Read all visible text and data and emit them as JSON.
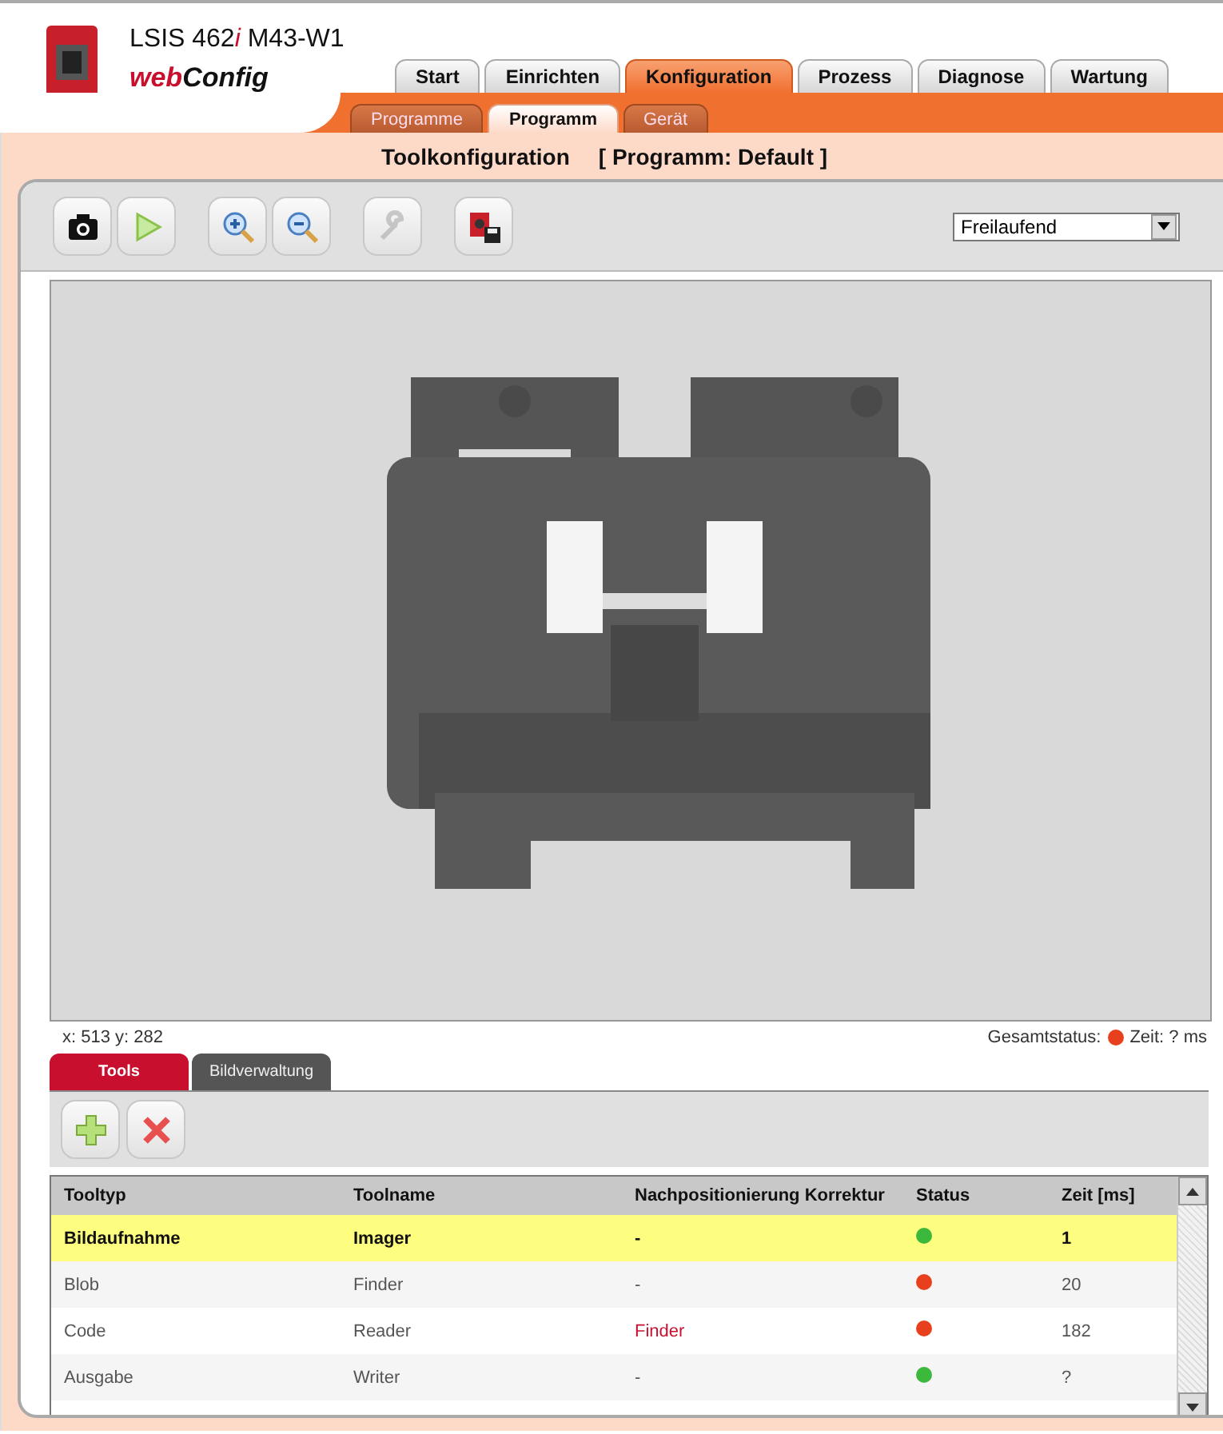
{
  "header": {
    "device_model": "LSIS 462",
    "device_suffix": "i",
    "device_variant": "M43-W1",
    "product_prefix": "web",
    "product_name": "Config"
  },
  "main_tabs": [
    {
      "label": "Start",
      "selected": false
    },
    {
      "label": "Einrichten",
      "selected": false
    },
    {
      "label": "Konfiguration",
      "selected": true
    },
    {
      "label": "Prozess",
      "selected": false
    },
    {
      "label": "Diagnose",
      "selected": false
    },
    {
      "label": "Wartung",
      "selected": false
    }
  ],
  "sub_tabs": [
    {
      "label": "Programme",
      "selected": false
    },
    {
      "label": "Programm",
      "selected": true
    },
    {
      "label": "Gerät",
      "selected": false
    }
  ],
  "page_title": {
    "title": "Toolkonfiguration",
    "program": "[ Programm: Default ]"
  },
  "toolbar": {
    "buttons": [
      {
        "kind": "camera",
        "disabled": false
      },
      {
        "kind": "play",
        "disabled": false
      },
      {
        "kind": "zoom-in",
        "disabled": false
      },
      {
        "kind": "zoom-out",
        "disabled": false
      },
      {
        "kind": "wrench",
        "disabled": true
      },
      {
        "kind": "save",
        "disabled": false
      }
    ],
    "mode": "Freilaufend"
  },
  "status": {
    "coords": "x: 513 y: 282",
    "overall_label": "Gesamtstatus:",
    "overall_ok": false,
    "time": "Zeit: ? ms"
  },
  "bottom_tabs": [
    {
      "label": "Tools",
      "selected": true
    },
    {
      "label": "Bildverwaltung",
      "selected": false
    }
  ],
  "tool_buttons": [
    {
      "kind": "add"
    },
    {
      "kind": "delete"
    }
  ],
  "table": {
    "columns": [
      "Tooltyp",
      "Toolname",
      "Nachpositionierung Korrektur",
      "Status",
      "Zeit [ms]"
    ],
    "rows": [
      {
        "type": "Bildaufnahme",
        "name": "Imager",
        "correction": "-",
        "correction_link": false,
        "color": "#3cb83c",
        "time": "1",
        "selected": true
      },
      {
        "type": "Blob",
        "name": "Finder",
        "correction": "-",
        "correction_link": false,
        "color": "#e8401c",
        "time": "20",
        "selected": false
      },
      {
        "type": "Code",
        "name": "Reader",
        "correction": "Finder",
        "correction_link": true,
        "color": "#e8401c",
        "time": "182",
        "selected": false
      },
      {
        "type": "Ausgabe",
        "name": "Writer",
        "correction": "-",
        "correction_link": false,
        "color": "#3cb83c",
        "time": "?",
        "selected": false
      }
    ]
  }
}
